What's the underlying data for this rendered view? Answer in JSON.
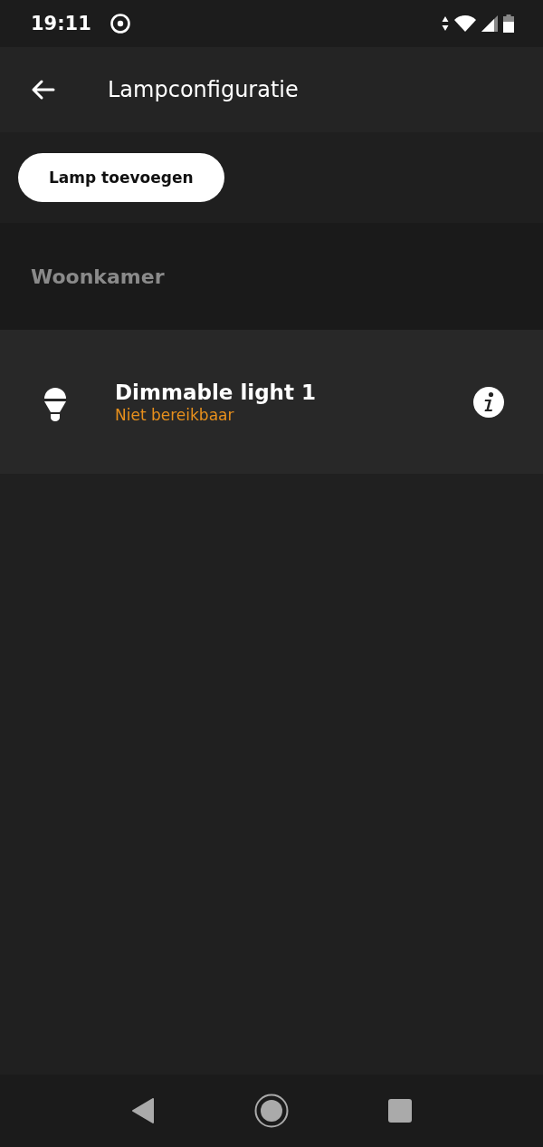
{
  "status_bar": {
    "time": "19:11"
  },
  "header": {
    "title": "Lampconfiguratie"
  },
  "add_button": {
    "label": "Lamp toevoegen"
  },
  "rooms": [
    {
      "name": "Woonkamer",
      "lights": [
        {
          "name": "Dimmable light 1",
          "status": "Niet bereikbaar",
          "reachable": false
        }
      ]
    }
  ]
}
